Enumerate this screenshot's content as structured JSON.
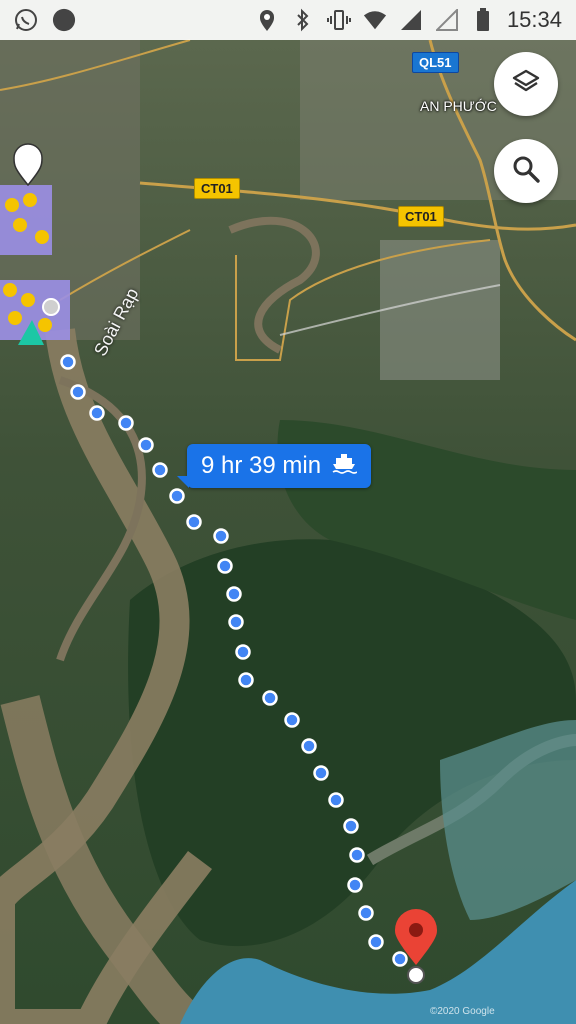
{
  "status_bar": {
    "time": "15:34",
    "left_icons": [
      "whatsapp-icon",
      "notification-dot-icon"
    ],
    "right_icons": [
      "location-pin-icon",
      "bluetooth-icon",
      "vibrate-icon",
      "wifi-icon",
      "cellular-signal-icon",
      "cellular-signal-empty-icon",
      "battery-icon"
    ]
  },
  "map": {
    "route": {
      "eta": "9 hr 39 min",
      "mode_icon": "ferry-icon",
      "color": "#4285f4"
    },
    "road_shields": [
      {
        "text": "QL51",
        "style": "blue"
      },
      {
        "text": "CT01",
        "style": "yellow"
      },
      {
        "text": "CT01",
        "style": "yellow"
      }
    ],
    "labels": {
      "an_phuoc": "AN PHƯỚC",
      "soai_rap": "Soài Rạp"
    },
    "credit": "©2020 Google"
  },
  "controls": {
    "layers_icon": "layers-icon",
    "search_icon": "search-icon"
  }
}
